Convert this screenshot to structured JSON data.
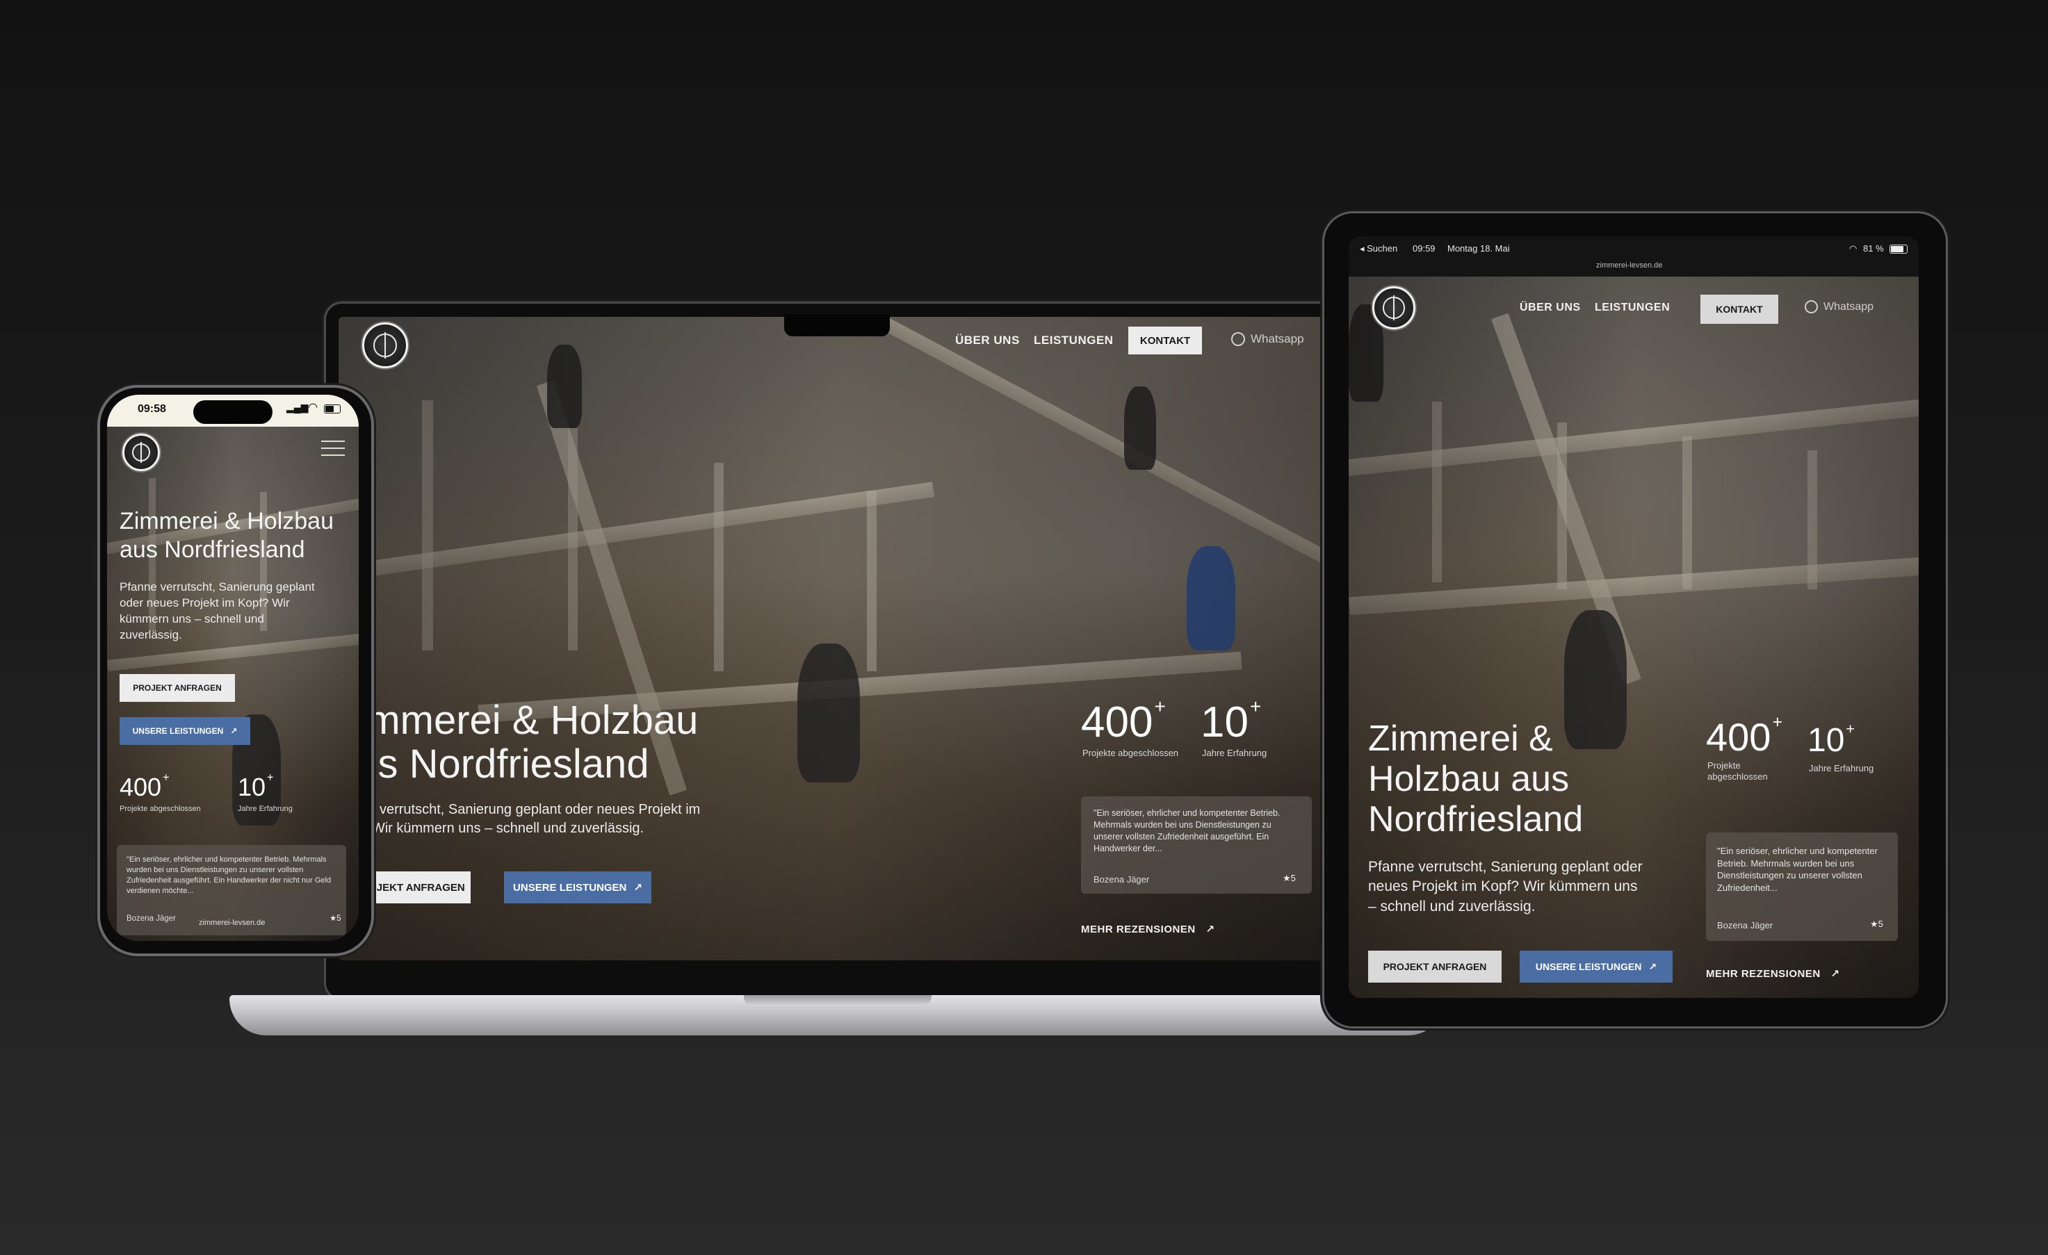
{
  "site": {
    "nav": {
      "about": "ÜBER UNS",
      "services": "LEISTUNGEN",
      "contact": "KONTAKT",
      "whatsapp": "Whatsapp"
    },
    "hero": {
      "title_line1": "Zimmerei & Holzbau",
      "title_line2": "aus Nordfriesland",
      "subtitle": "Pfanne verrutscht, Sanierung geplant oder neues Projekt im Kopf? Wir kümmern uns – schnell und zuverlässig.",
      "cta_primary": "PROJEKT ANFRAGEN",
      "cta_secondary": "UNSERE LEISTUNGEN"
    },
    "stats": [
      {
        "value": "400",
        "suffix": "+",
        "label": "Projekte abgeschlossen"
      },
      {
        "value": "10",
        "suffix": "+",
        "label": "Jahre Erfahrung"
      }
    ],
    "review": {
      "text": "\"Ein seriöser, ehrlicher und kompetenter Betrieb. Mehrmals wurden bei uns Dienstleistungen zu unserer vollsten Zufriedenheit ausgeführt. Ein Handwerker der...",
      "text_phone": "\"Ein seriöser, ehrlicher und kompetenter Betrieb. Mehrmals wurden bei uns Dienstleistungen zu unserer vollsten Zufriedenheit ausgeführt. Ein Handwerker der nicht nur Geld verdienen möchte...",
      "text_tablet": "\"Ein seriöser, ehrlicher und kompetenter Betrieb. Mehrmals wurden bei uns Dienstleistungen zu unserer vollsten Zufriedenheit...",
      "author": "Bozena Jäger",
      "rating": "★5"
    },
    "more_reviews": "MEHR REZENSIONEN",
    "arrow": "↗",
    "url": "zimmerei-levsen.de"
  },
  "tablet_status": {
    "back": "◂ Suchen",
    "time": "09:59",
    "date": "Montag 18. Mai",
    "battery": "81 %"
  },
  "phone_status": {
    "time": "09:58"
  },
  "colors": {
    "accent_blue": "#4a6ea3",
    "button_light": "#ececec",
    "background": "#1b1b1b"
  }
}
